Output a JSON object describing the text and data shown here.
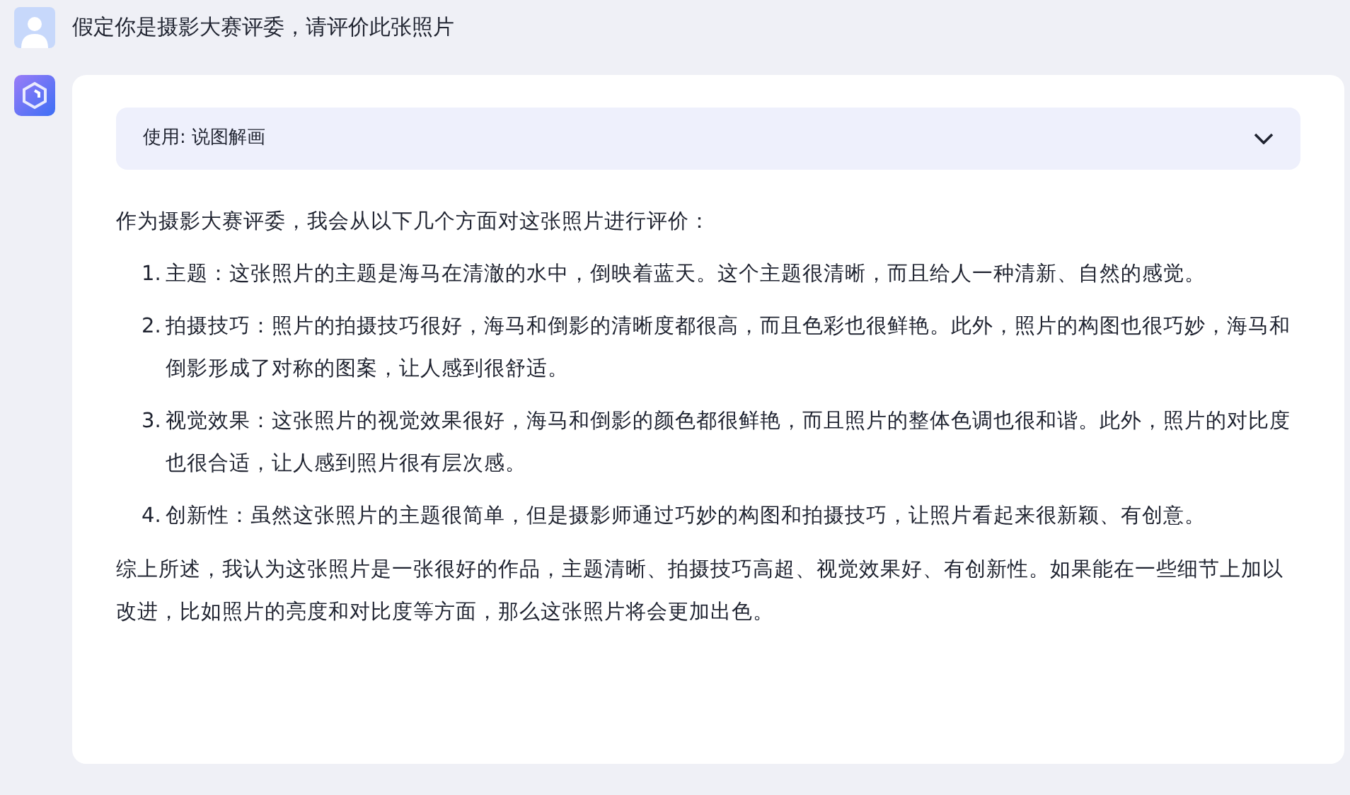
{
  "user_message": {
    "text": "假定你是摄影大赛评委，请评价此张照片"
  },
  "reply": {
    "plugin": {
      "label": "使用: 说图解画",
      "expanded": false
    },
    "intro": "作为摄影大赛评委，我会从以下几个方面对这张照片进行评价：",
    "points": [
      {
        "number": "1.",
        "text": "主题：这张照片的主题是海马在清澈的水中，倒映着蓝天。这个主题很清晰，而且给人一种清新、自然的感觉。"
      },
      {
        "number": "2.",
        "text": "拍摄技巧：照片的拍摄技巧很好，海马和倒影的清晰度都很高，而且色彩也很鲜艳。此外，照片的构图也很巧妙，海马和倒影形成了对称的图案，让人感到很舒适。"
      },
      {
        "number": "3.",
        "text": "视觉效果：这张照片的视觉效果很好，海马和倒影的颜色都很鲜艳，而且照片的整体色调也很和谐。此外，照片的对比度也很合适，让人感到照片很有层次感。"
      },
      {
        "number": "4.",
        "text": "创新性：虽然这张照片的主题很简单，但是摄影师通过巧妙的构图和拍摄技巧，让照片看起来很新颖、有创意。"
      }
    ],
    "conclusion": "综上所述，我认为这张照片是一张很好的作品，主题清晰、拍摄技巧高超、视觉效果好、有创新性。如果能在一些细节上加以改进，比如照片的亮度和对比度等方面，那么这张照片将会更加出色。"
  }
}
